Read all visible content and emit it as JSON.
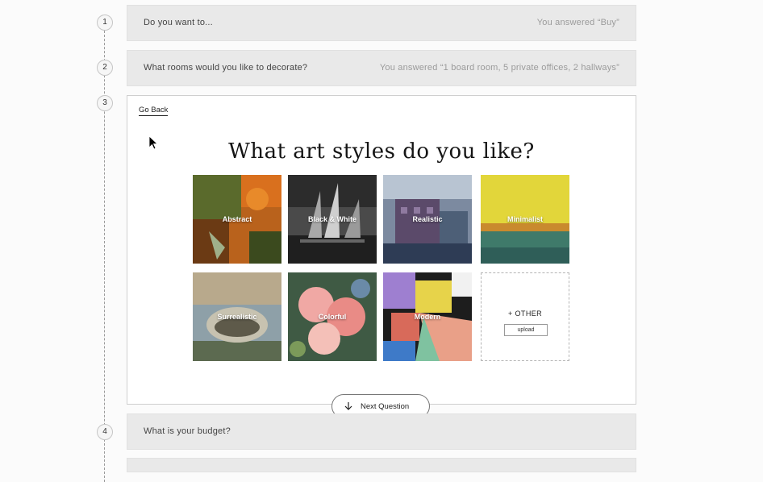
{
  "steps": {
    "s1": {
      "number": "1",
      "question": "Do you want to...",
      "answer": "You answered “Buy”"
    },
    "s2": {
      "number": "2",
      "question": "What rooms would you like to decorate?",
      "answer": "You answered “1 board room, 5 private offices, 2 hallways”"
    },
    "s3": {
      "number": "3"
    },
    "s4": {
      "number": "4",
      "question": "What is your budget?"
    }
  },
  "card": {
    "go_back": "Go Back",
    "title": "What art styles do you like?",
    "styles": [
      "Abstract",
      "Black & White",
      "Realistic",
      "Minimalist",
      "Surrealistic",
      "Colorful",
      "Modern"
    ],
    "other_label": "+ OTHER",
    "upload_label": "upload"
  },
  "next_button": "Next Question"
}
